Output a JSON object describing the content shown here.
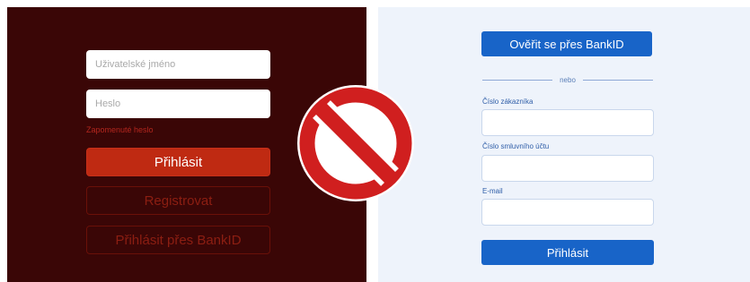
{
  "left_form": {
    "username_placeholder": "Uživatelské jméno",
    "password_placeholder": "Heslo",
    "forgot_password": "Zapomenuté heslo",
    "login_button": "Přihlásit",
    "register_button": "Registrovat",
    "bankid_login_button": "Přihlásit přes BankID"
  },
  "right_form": {
    "bankid_button": "Ověřit se přes BankID",
    "divider_text": "nebo",
    "customer_number_label": "Číslo zákazníka",
    "contract_account_label": "Číslo smluvního účtu",
    "email_label": "E-mail",
    "submit_button": "Přihlásit"
  },
  "overlay": {
    "icon": "prohibition-sign-icon",
    "color": "#d01f1f"
  },
  "colors": {
    "left_background": "#3a0606",
    "left_accent": "#bf2a12",
    "right_background": "#eef3fb",
    "right_accent": "#1864c8"
  }
}
